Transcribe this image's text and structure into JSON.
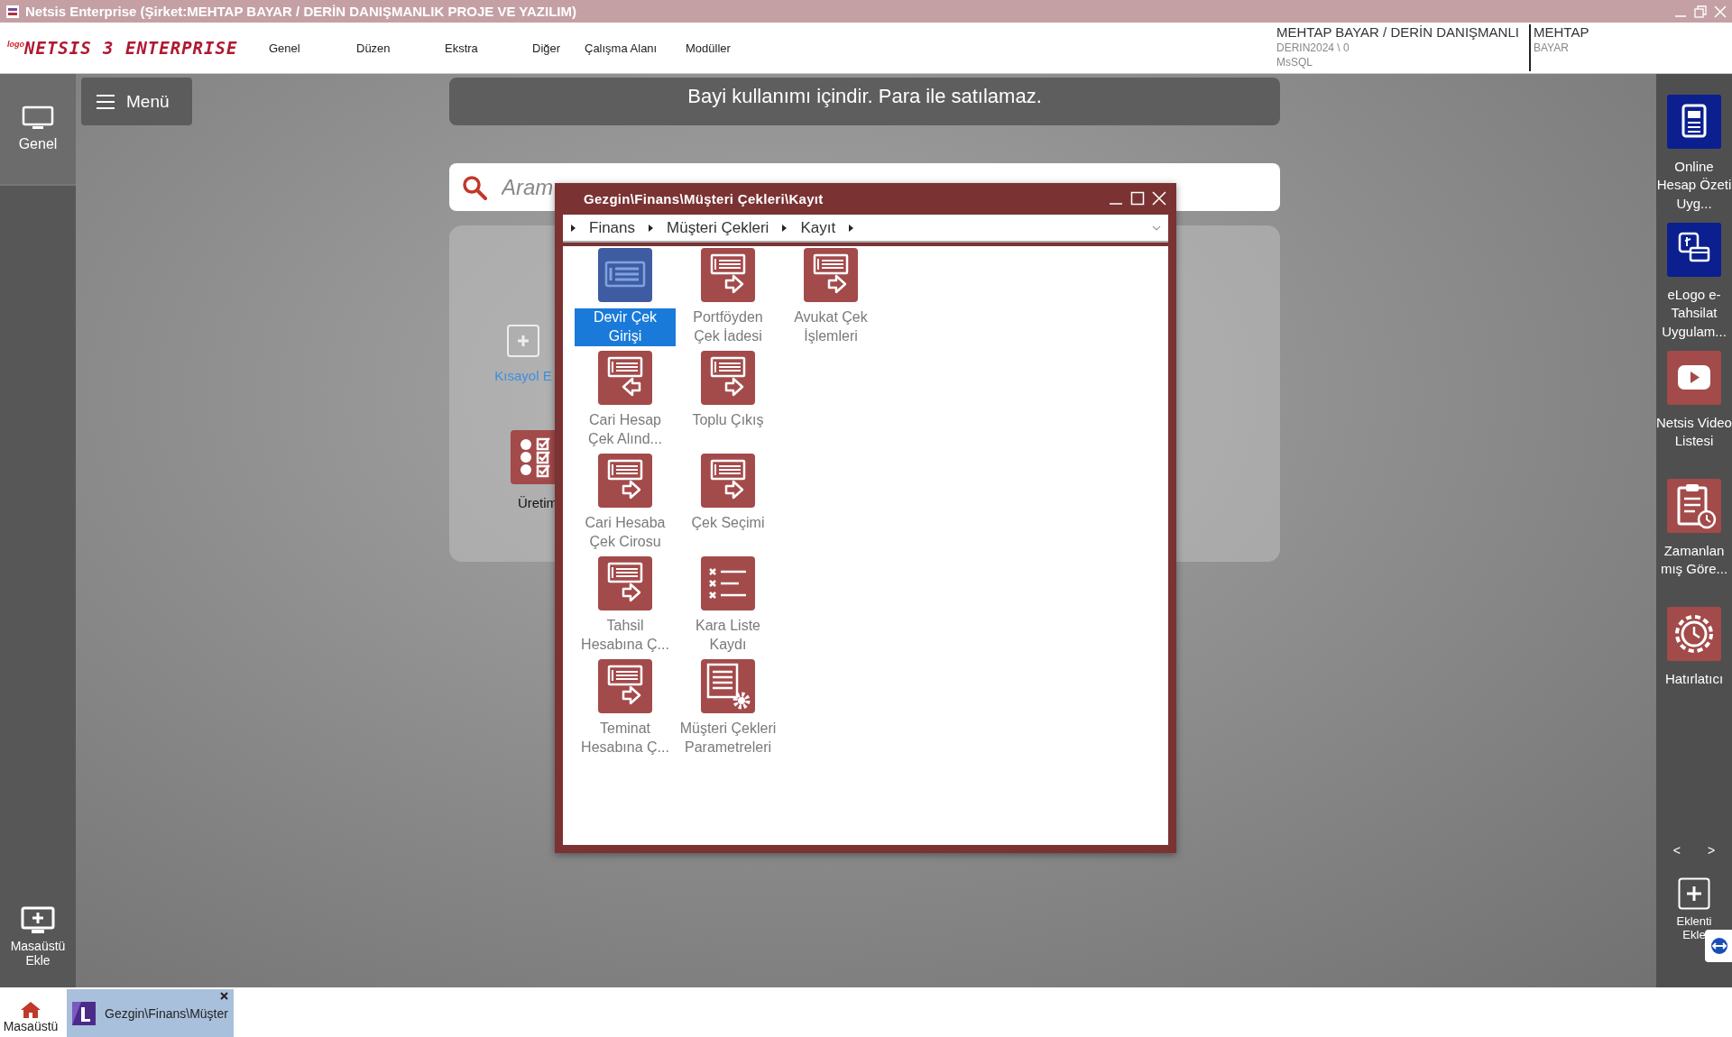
{
  "title_bar": {
    "title": "Netsis Enterprise (Şirket:MEHTAP BAYAR / DERİN DANIŞMANLIK PROJE VE YAZILIM)"
  },
  "header": {
    "logo": {
      "prefix": "logo",
      "name": "NETSIS 3 ENTERPRISE"
    },
    "menu": [
      "Genel",
      "Düzen",
      "Ekstra",
      "Diğer",
      "Çalışma Alanı",
      "Modüller"
    ],
    "company": {
      "name": "MEHTAP BAYAR / DERİN DANIŞMANLI",
      "database": "DERIN2024 \\ 0",
      "server": "MsSQL"
    },
    "user": {
      "first": "MEHTAP",
      "last": "BAYAR"
    }
  },
  "left_sidebar": {
    "items": [
      {
        "label": "Genel",
        "selected": true
      }
    ],
    "add_desktop": "Masaüstü Ekle"
  },
  "menu_button": "Menü",
  "banner": "Bayi kullanımı içindir. Para ile satılamaz.",
  "search": {
    "placeholder": "Aram"
  },
  "shortcuts": [
    {
      "kind": "add",
      "label": "Kısayol E"
    },
    {
      "kind": "module",
      "label": "Üretim"
    }
  ],
  "dialog": {
    "title": "Gezgin\\Finans\\Müşteri Çekleri\\Kayıt",
    "breadcrumb": [
      "Finans",
      "Müşteri Çekleri",
      "Kayıt"
    ],
    "rows": [
      [
        {
          "kind": "card",
          "label": "Devir Çek Girişi",
          "selected": true
        },
        {
          "kind": "out",
          "label": "Portföyden Çek İadesi",
          "selected": false
        },
        {
          "kind": "out",
          "label": "Avukat Çek İşlemleri",
          "selected": false
        }
      ],
      [
        {
          "kind": "in",
          "label": "Cari Hesap Çek Alınd...",
          "selected": false
        },
        {
          "kind": "out",
          "label": "Toplu Çıkış",
          "selected": false
        }
      ],
      [
        {
          "kind": "out",
          "label": "Cari Hesaba Çek Cirosu",
          "selected": false
        },
        {
          "kind": "out",
          "label": "Çek Seçimi",
          "selected": false
        }
      ],
      [
        {
          "kind": "out",
          "label": "Tahsil Hesabına Ç...",
          "selected": false
        },
        {
          "kind": "blacklist",
          "label": "Kara Liste Kaydı",
          "selected": false
        }
      ],
      [
        {
          "kind": "out",
          "label": "Teminat Hesabına Ç...",
          "selected": false
        },
        {
          "kind": "settings",
          "label": "Müşteri Çekleri Parametreleri",
          "selected": false
        }
      ]
    ]
  },
  "right_sidebar": {
    "apps": [
      {
        "kind": "document",
        "label": "Online Hesap Özeti Uyg...",
        "color": "#0b1f8f"
      },
      {
        "kind": "payment",
        "label": "eLogo e-Tahsilat Uygulam...",
        "color": "#0b1f8f"
      },
      {
        "kind": "video",
        "label": "Netsis Video Listesi",
        "color": "#a34a4a"
      },
      {
        "kind": "schedule",
        "label": "Zamanlan mış Göre...",
        "color": "#a34a4a"
      },
      {
        "kind": "reminder",
        "label": "Hatırlatıcı",
        "color": "#a34a4a"
      }
    ],
    "nav": [
      "<",
      ">"
    ],
    "add": "Eklenti Ekle"
  },
  "taskbar": {
    "home": "Masaüstü",
    "tabs": [
      {
        "label": "Gezgin\\Finans\\Müşter",
        "selected": true
      }
    ]
  }
}
